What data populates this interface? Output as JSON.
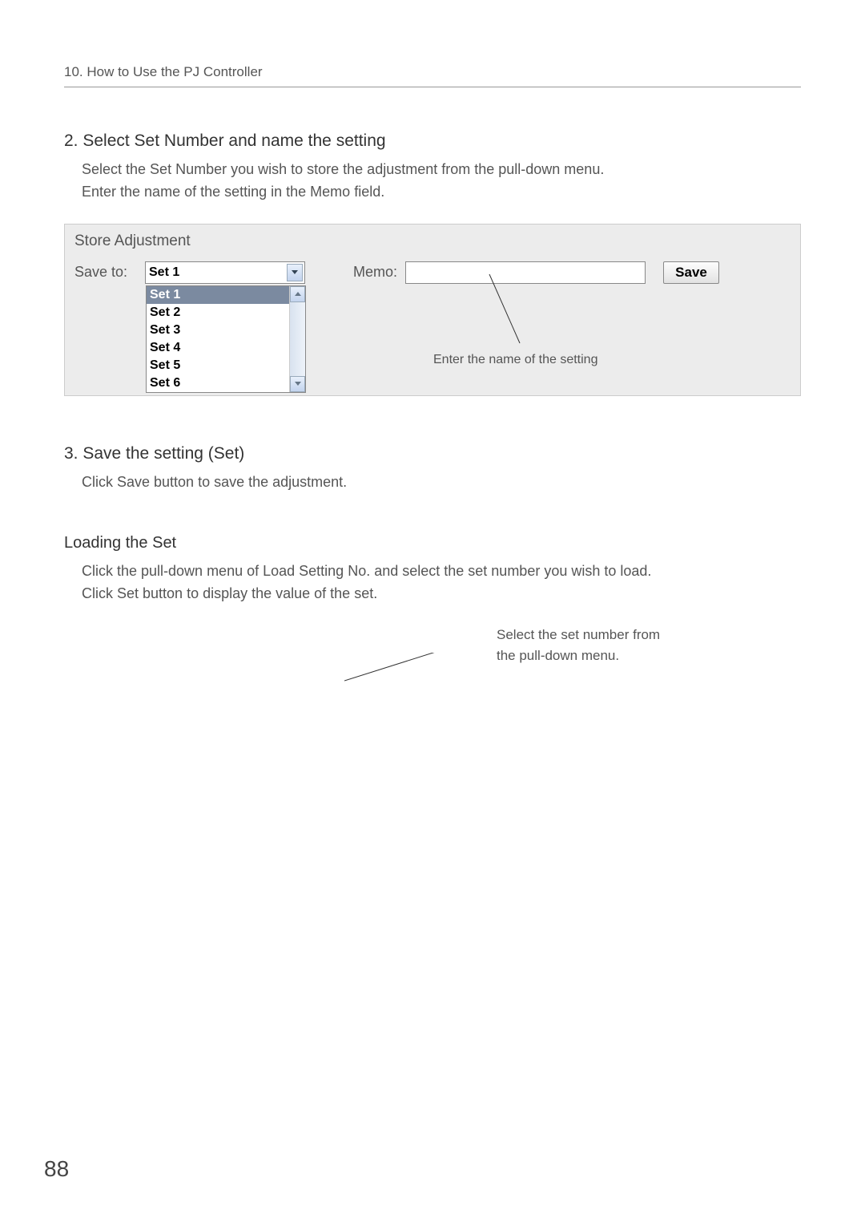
{
  "header": {
    "chapter": "10. How to Use the PJ Controller"
  },
  "section2": {
    "title": "2. Select Set Number and name the setting",
    "body1": "Select the Set Number you wish to store the adjustment from the pull-down menu.",
    "body2": "Enter the name of the setting in the Memo field."
  },
  "store": {
    "panel_title": "Store Adjustment",
    "saveto_label": "Save to:",
    "selected": "Set 1",
    "memo_label": "Memo:",
    "memo_value": "",
    "save_button": "Save",
    "options": [
      "Set 1",
      "Set 2",
      "Set 3",
      "Set 4",
      "Set 5",
      "Set 6"
    ],
    "callout": "Enter the name of the setting"
  },
  "section3": {
    "title": "3. Save the setting (Set)",
    "body": "Click Save button to save the adjustment."
  },
  "loading": {
    "title": "Loading the Set",
    "body1": "Click the pull-down menu of Load Setting No. and select the set number you wish to load.",
    "body2": "Click Set button to display the value of the set.",
    "callout1": "Select the set number from",
    "callout2": "the pull-down menu."
  },
  "page_number": "88"
}
